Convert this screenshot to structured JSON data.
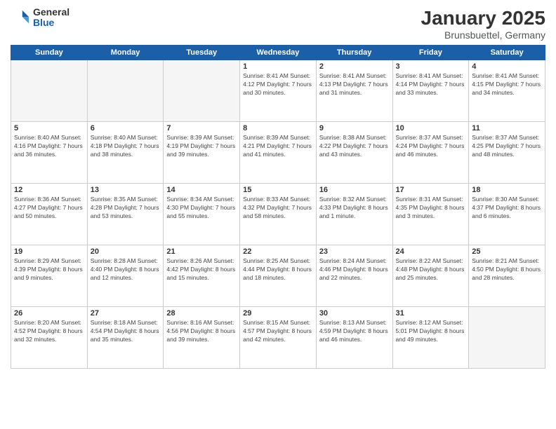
{
  "logo": {
    "general": "General",
    "blue": "Blue"
  },
  "title": "January 2025",
  "subtitle": "Brunsbuettel, Germany",
  "days_header": [
    "Sunday",
    "Monday",
    "Tuesday",
    "Wednesday",
    "Thursday",
    "Friday",
    "Saturday"
  ],
  "weeks": [
    [
      {
        "num": "",
        "info": ""
      },
      {
        "num": "",
        "info": ""
      },
      {
        "num": "",
        "info": ""
      },
      {
        "num": "1",
        "info": "Sunrise: 8:41 AM\nSunset: 4:12 PM\nDaylight: 7 hours\nand 30 minutes."
      },
      {
        "num": "2",
        "info": "Sunrise: 8:41 AM\nSunset: 4:13 PM\nDaylight: 7 hours\nand 31 minutes."
      },
      {
        "num": "3",
        "info": "Sunrise: 8:41 AM\nSunset: 4:14 PM\nDaylight: 7 hours\nand 33 minutes."
      },
      {
        "num": "4",
        "info": "Sunrise: 8:41 AM\nSunset: 4:15 PM\nDaylight: 7 hours\nand 34 minutes."
      }
    ],
    [
      {
        "num": "5",
        "info": "Sunrise: 8:40 AM\nSunset: 4:16 PM\nDaylight: 7 hours\nand 36 minutes."
      },
      {
        "num": "6",
        "info": "Sunrise: 8:40 AM\nSunset: 4:18 PM\nDaylight: 7 hours\nand 38 minutes."
      },
      {
        "num": "7",
        "info": "Sunrise: 8:39 AM\nSunset: 4:19 PM\nDaylight: 7 hours\nand 39 minutes."
      },
      {
        "num": "8",
        "info": "Sunrise: 8:39 AM\nSunset: 4:21 PM\nDaylight: 7 hours\nand 41 minutes."
      },
      {
        "num": "9",
        "info": "Sunrise: 8:38 AM\nSunset: 4:22 PM\nDaylight: 7 hours\nand 43 minutes."
      },
      {
        "num": "10",
        "info": "Sunrise: 8:37 AM\nSunset: 4:24 PM\nDaylight: 7 hours\nand 46 minutes."
      },
      {
        "num": "11",
        "info": "Sunrise: 8:37 AM\nSunset: 4:25 PM\nDaylight: 7 hours\nand 48 minutes."
      }
    ],
    [
      {
        "num": "12",
        "info": "Sunrise: 8:36 AM\nSunset: 4:27 PM\nDaylight: 7 hours\nand 50 minutes."
      },
      {
        "num": "13",
        "info": "Sunrise: 8:35 AM\nSunset: 4:28 PM\nDaylight: 7 hours\nand 53 minutes."
      },
      {
        "num": "14",
        "info": "Sunrise: 8:34 AM\nSunset: 4:30 PM\nDaylight: 7 hours\nand 55 minutes."
      },
      {
        "num": "15",
        "info": "Sunrise: 8:33 AM\nSunset: 4:32 PM\nDaylight: 7 hours\nand 58 minutes."
      },
      {
        "num": "16",
        "info": "Sunrise: 8:32 AM\nSunset: 4:33 PM\nDaylight: 8 hours\nand 1 minute."
      },
      {
        "num": "17",
        "info": "Sunrise: 8:31 AM\nSunset: 4:35 PM\nDaylight: 8 hours\nand 3 minutes."
      },
      {
        "num": "18",
        "info": "Sunrise: 8:30 AM\nSunset: 4:37 PM\nDaylight: 8 hours\nand 6 minutes."
      }
    ],
    [
      {
        "num": "19",
        "info": "Sunrise: 8:29 AM\nSunset: 4:39 PM\nDaylight: 8 hours\nand 9 minutes."
      },
      {
        "num": "20",
        "info": "Sunrise: 8:28 AM\nSunset: 4:40 PM\nDaylight: 8 hours\nand 12 minutes."
      },
      {
        "num": "21",
        "info": "Sunrise: 8:26 AM\nSunset: 4:42 PM\nDaylight: 8 hours\nand 15 minutes."
      },
      {
        "num": "22",
        "info": "Sunrise: 8:25 AM\nSunset: 4:44 PM\nDaylight: 8 hours\nand 18 minutes."
      },
      {
        "num": "23",
        "info": "Sunrise: 8:24 AM\nSunset: 4:46 PM\nDaylight: 8 hours\nand 22 minutes."
      },
      {
        "num": "24",
        "info": "Sunrise: 8:22 AM\nSunset: 4:48 PM\nDaylight: 8 hours\nand 25 minutes."
      },
      {
        "num": "25",
        "info": "Sunrise: 8:21 AM\nSunset: 4:50 PM\nDaylight: 8 hours\nand 28 minutes."
      }
    ],
    [
      {
        "num": "26",
        "info": "Sunrise: 8:20 AM\nSunset: 4:52 PM\nDaylight: 8 hours\nand 32 minutes."
      },
      {
        "num": "27",
        "info": "Sunrise: 8:18 AM\nSunset: 4:54 PM\nDaylight: 8 hours\nand 35 minutes."
      },
      {
        "num": "28",
        "info": "Sunrise: 8:16 AM\nSunset: 4:56 PM\nDaylight: 8 hours\nand 39 minutes."
      },
      {
        "num": "29",
        "info": "Sunrise: 8:15 AM\nSunset: 4:57 PM\nDaylight: 8 hours\nand 42 minutes."
      },
      {
        "num": "30",
        "info": "Sunrise: 8:13 AM\nSunset: 4:59 PM\nDaylight: 8 hours\nand 46 minutes."
      },
      {
        "num": "31",
        "info": "Sunrise: 8:12 AM\nSunset: 5:01 PM\nDaylight: 8 hours\nand 49 minutes."
      },
      {
        "num": "",
        "info": ""
      }
    ]
  ]
}
